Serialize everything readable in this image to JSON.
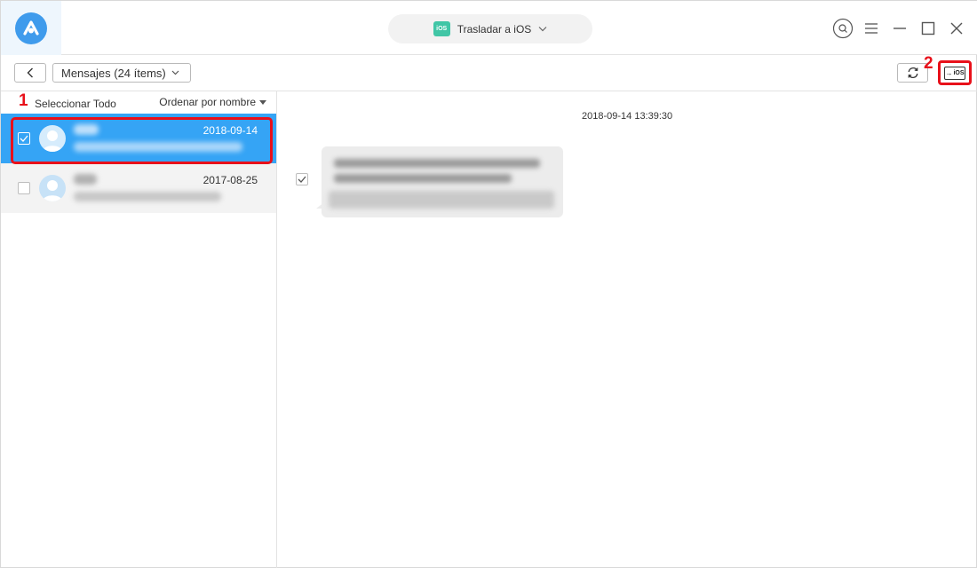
{
  "titlebar": {
    "mode": {
      "badge_text": "iOS",
      "label": "Trasladar a iOS"
    },
    "controls": [
      "search-icon",
      "menu-icon",
      "minimize-icon",
      "maximize-icon",
      "close-icon"
    ]
  },
  "toolbar": {
    "category_label": "Mensajes (24 ítems)",
    "to_ios_label": "iOS"
  },
  "annotations": {
    "step1": "1",
    "step2": "2"
  },
  "list": {
    "select_all": "Seleccionar Todo",
    "sort_label": "Ordenar por nombre",
    "conversations": [
      {
        "date": "2018-09-14",
        "selected": true,
        "checked": true
      },
      {
        "date": "2017-08-25",
        "selected": false,
        "checked": false
      }
    ]
  },
  "detail": {
    "timestamp": "2018-09-14 13:39:30",
    "message_checked": true
  },
  "colors": {
    "accent": "#35a4f5",
    "logo": "#3f9bec",
    "ios_badge": "#41c6a6",
    "annotation_red": "#e8101a"
  }
}
